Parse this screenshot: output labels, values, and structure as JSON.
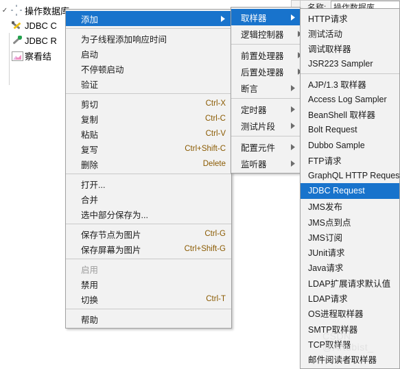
{
  "background": {
    "tree": {
      "root": {
        "label": "操作数据库",
        "icon": "gear-icon",
        "expanded": true
      },
      "children": [
        {
          "label": "JDBC C",
          "icon": "jdbc-config-icon"
        },
        {
          "label": "JDBC R",
          "icon": "jdbc-request-icon"
        },
        {
          "label": "察看结",
          "icon": "view-results-tree-icon"
        }
      ]
    },
    "panel_field_text": "操作数据库",
    "panel_label_text": "名称:"
  },
  "watermark": "CSDN @Artubist_",
  "menu1": {
    "name": "node-context-menu",
    "items": [
      {
        "label": "添加",
        "submenu": true,
        "selected": true,
        "accel": ""
      },
      {
        "sep": true
      },
      {
        "label": "为子线程添加响应时间",
        "accel": ""
      },
      {
        "label": "启动",
        "accel": ""
      },
      {
        "label": "不停顿启动",
        "accel": ""
      },
      {
        "label": "验证",
        "accel": ""
      },
      {
        "sep": true
      },
      {
        "label": "剪切",
        "accel": "Ctrl-X"
      },
      {
        "label": "复制",
        "accel": "Ctrl-C"
      },
      {
        "label": "粘贴",
        "accel": "Ctrl-V"
      },
      {
        "label": "复写",
        "accel": "Ctrl+Shift-C"
      },
      {
        "label": "删除",
        "accel": "Delete"
      },
      {
        "sep": true
      },
      {
        "label": "打开...",
        "accel": ""
      },
      {
        "label": "合并",
        "accel": ""
      },
      {
        "label": "选中部分保存为...",
        "accel": ""
      },
      {
        "sep": true
      },
      {
        "label": "保存节点为图片",
        "accel": "Ctrl-G"
      },
      {
        "label": "保存屏幕为图片",
        "accel": "Ctrl+Shift-G"
      },
      {
        "sep": true
      },
      {
        "label": "启用",
        "accel": "",
        "disabled": true
      },
      {
        "label": "禁用",
        "accel": ""
      },
      {
        "label": "切换",
        "accel": "Ctrl-T"
      },
      {
        "sep": true
      },
      {
        "label": "帮助",
        "accel": ""
      }
    ]
  },
  "menu2": {
    "name": "add-submenu",
    "items": [
      {
        "label": "取样器",
        "submenu": true,
        "selected": true
      },
      {
        "label": "逻辑控制器",
        "submenu": true
      },
      {
        "sep": true
      },
      {
        "label": "前置处理器",
        "submenu": true
      },
      {
        "label": "后置处理器",
        "submenu": true
      },
      {
        "label": "断言",
        "submenu": true
      },
      {
        "sep": true
      },
      {
        "label": "定时器",
        "submenu": true
      },
      {
        "label": "测试片段",
        "submenu": true
      },
      {
        "sep": true
      },
      {
        "label": "配置元件",
        "submenu": true
      },
      {
        "label": "监听器",
        "submenu": true
      }
    ]
  },
  "menu3": {
    "name": "sampler-submenu",
    "items": [
      {
        "label": "HTTP请求"
      },
      {
        "label": "测试活动"
      },
      {
        "label": "调试取样器"
      },
      {
        "label": "JSR223 Sampler"
      },
      {
        "sep": true
      },
      {
        "label": "AJP/1.3 取样器"
      },
      {
        "label": "Access Log Sampler"
      },
      {
        "label": "BeanShell 取样器"
      },
      {
        "label": "Bolt Request"
      },
      {
        "label": "Dubbo Sample"
      },
      {
        "label": "FTP请求"
      },
      {
        "label": "GraphQL HTTP Request"
      },
      {
        "label": "JDBC Request",
        "selected": true
      },
      {
        "label": "JMS发布"
      },
      {
        "label": "JMS点到点"
      },
      {
        "label": "JMS订阅"
      },
      {
        "label": "JUnit请求"
      },
      {
        "label": "Java请求"
      },
      {
        "label": "LDAP扩展请求默认值"
      },
      {
        "label": "LDAP请求"
      },
      {
        "label": "OS进程取样器"
      },
      {
        "label": "SMTP取样器"
      },
      {
        "label": "TCP取样器"
      },
      {
        "label": "邮件阅读者取样器"
      }
    ]
  },
  "colors": {
    "menu_bg": "#f2f2f2",
    "menu_border": "#a0a0a0",
    "highlight": "#1873cc",
    "highlight_text": "#ffffff",
    "accel_text": "#8a5a00",
    "disabled_text": "#9d9d9d"
  }
}
